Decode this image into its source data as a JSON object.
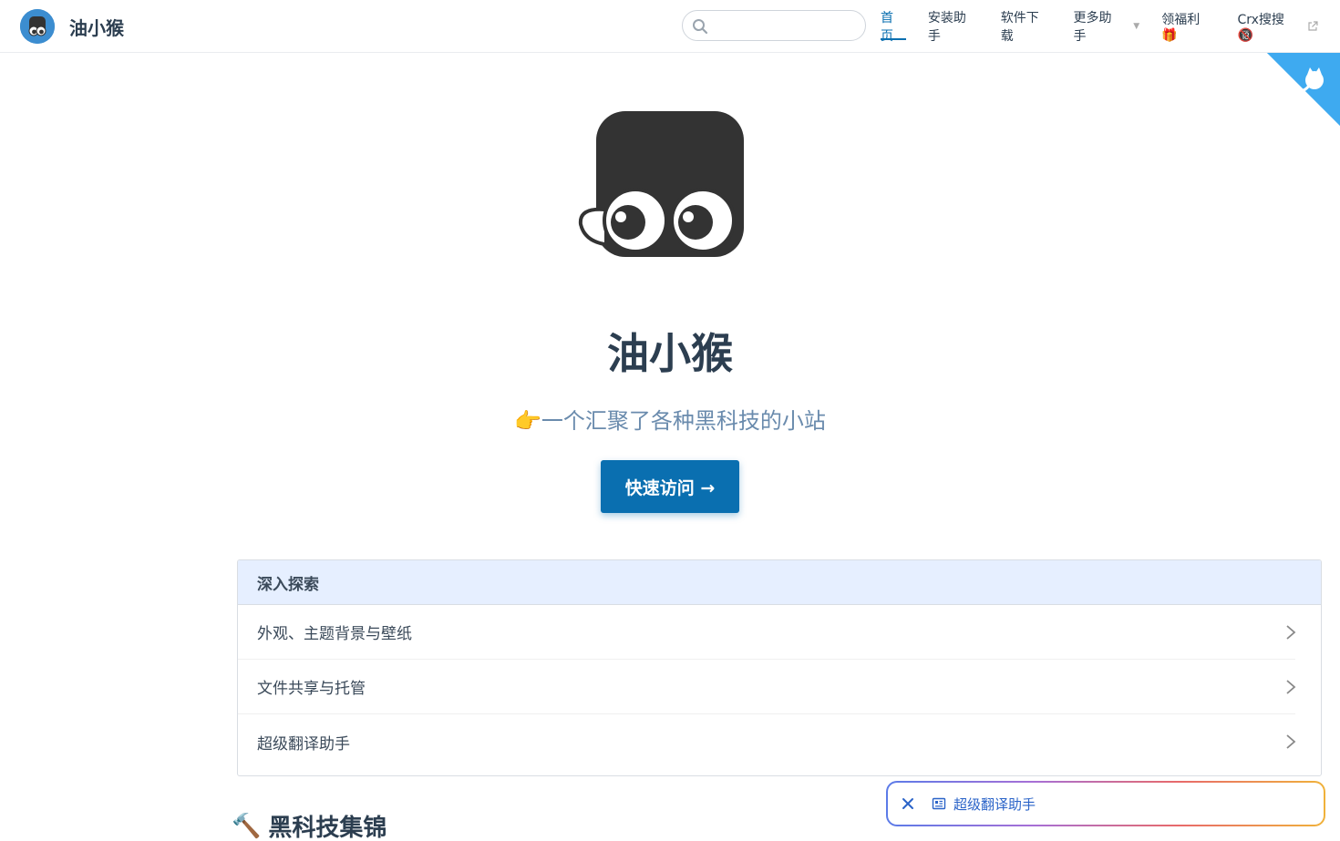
{
  "navbar": {
    "brand_title": "油小猴",
    "search_placeholder": "",
    "links": [
      {
        "label": "首页",
        "active": true
      },
      {
        "label": "安装助手"
      },
      {
        "label": "软件下载"
      },
      {
        "label": "更多助手",
        "dropdown": true
      },
      {
        "label": "领福利🎁"
      },
      {
        "label": "Crx搜搜🔞",
        "external": true
      }
    ]
  },
  "hero": {
    "title": "油小猴",
    "description": "👉一个汇聚了各种黑科技的小站",
    "action_label": "快速访问 →"
  },
  "explore": {
    "header": "深入探索",
    "items": [
      {
        "label": "外观、主题背景与壁纸"
      },
      {
        "label": "文件共享与托管"
      },
      {
        "label": "超级翻译助手"
      }
    ]
  },
  "section": {
    "emoji": "🔨",
    "title": "黑科技集锦"
  },
  "floating_bar": {
    "label": "超级翻译助手"
  },
  "colors": {
    "accent": "#0a6fb0",
    "panel_header_bg": "#e6efff",
    "text": "#2c3e50",
    "description": "#6a8bad",
    "github_corner": "#3eaaf0"
  }
}
